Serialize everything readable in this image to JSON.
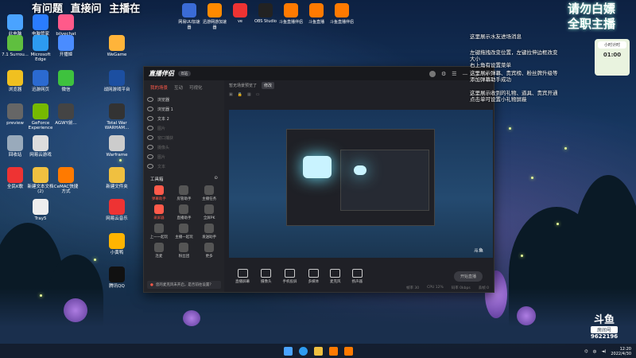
{
  "banner": [
    "有问题",
    "直接问",
    "主播在"
  ],
  "top_icons": [
    {
      "label": "网易UU加速器",
      "color": "#3a6bd6"
    },
    {
      "label": "迅游网游加速器",
      "color": "#ff8a00"
    },
    {
      "label": "ve",
      "color": "#e33"
    },
    {
      "label": "OBS Studio",
      "color": "#222"
    },
    {
      "label": "斗鱼直播伴侣",
      "color": "#ff7a00"
    },
    {
      "label": "斗鱼直播",
      "color": "#ff7a00"
    },
    {
      "label": "斗鱼直播伴侣",
      "color": "#ff7a00"
    }
  ],
  "desktop_icons": [
    {
      "label": "此电脑",
      "color": "#4aa3ff"
    },
    {
      "label": "电脑管家",
      "color": "#2a7cff"
    },
    {
      "label": "bilvechat",
      "color": "#ff5a8a"
    },
    {
      "label": "7.1 Surrou...",
      "color": "#5fbf3f"
    },
    {
      "label": "Microsoft Edge",
      "color": "#2d9bf0"
    },
    {
      "label": "开播姬",
      "color": "#4a8cff"
    },
    {
      "label": "WeGame",
      "color": "#ffb43a"
    },
    {
      "label": "浏览器",
      "color": "#f0c020"
    },
    {
      "label": "迅游网页",
      "color": "#2b6ad0"
    },
    {
      "label": "微信",
      "color": "#3ec23e"
    },
    {
      "label": "战网游戏平台",
      "color": "#1c4fa1"
    },
    {
      "label": "preview",
      "color": "#666"
    },
    {
      "label": "GeForce Experience",
      "color": "#76b900"
    },
    {
      "label": "AGWY前...",
      "color": "#444"
    },
    {
      "label": "Total War WARHAM...",
      "color": "#333"
    },
    {
      "label": "回收站",
      "color": "#9ab"
    },
    {
      "label": "网易云游戏",
      "color": "#ddd"
    },
    {
      "label": "Warframe",
      "color": "#ccc"
    },
    {
      "label": "全民K歌",
      "color": "#e33"
    },
    {
      "label": "新建文本文档(2)",
      "color": "#f0c040"
    },
    {
      "label": "CeMAC快捷方式",
      "color": "#ff7a00"
    },
    {
      "label": "新建文件夹",
      "color": "#f0c040"
    },
    {
      "label": "Tray5",
      "color": "#eee"
    },
    {
      "label": "网易云音乐",
      "color": "#e33"
    },
    {
      "label": "小黄鸭",
      "color": "#ffb400"
    },
    {
      "label": "腾讯QQ",
      "color": "#111"
    }
  ],
  "app": {
    "logo": "直播伴侣",
    "version": "B站",
    "tabs": [
      "我的场景",
      "互动",
      "可视化"
    ],
    "sources": [
      {
        "label": "浏览器",
        "dim": false
      },
      {
        "label": "浏览器 1",
        "dim": false
      },
      {
        "label": "文本 2",
        "dim": false
      },
      {
        "label": "图片",
        "dim": true
      },
      {
        "label": "窗口捕获",
        "dim": true
      },
      {
        "label": "摄像头",
        "dim": true
      },
      {
        "label": "图片",
        "dim": true
      },
      {
        "label": "文本",
        "dim": true
      }
    ],
    "tools_title": "工具箱",
    "tools": [
      {
        "label": "弹幕助手",
        "red": true
      },
      {
        "label": "房管助手",
        "red": false
      },
      {
        "label": "主播任务",
        "red": false
      },
      {
        "label": "录屏器",
        "red": true
      },
      {
        "label": "直播助手",
        "red": false
      },
      {
        "label": "全屏PK",
        "red": false
      },
      {
        "label": "上一一起玩",
        "red": false
      },
      {
        "label": "主播一起玩",
        "red": false
      },
      {
        "label": "发送助手",
        "red": false
      },
      {
        "label": "连麦",
        "red": false
      },
      {
        "label": "粉丝团",
        "red": false
      },
      {
        "label": "更多",
        "red": false
      }
    ],
    "notice": "您的麦克风未开启，是否前往设置？",
    "scene_text": "暂无场景预览了",
    "scene_btn": "修改",
    "controls": [
      "直播屏幕",
      "摄像头",
      "手机投屏",
      "多媒体",
      "麦克风",
      "扬声器"
    ],
    "start_label": "开始直播",
    "status": [
      "帧率 30",
      "CPU 12%",
      "码率 0kbps",
      "丢帧 0"
    ]
  },
  "overlay": [
    "这里展示水友进场消息",
    "左键拖拽改变位置，左键拉伸边框改变",
    "大小",
    "右上角有设置菜单",
    "这里展示弹幕、贵宾榜、粉丝牌升级等",
    "添加弹幕助手成功",
    "这里展示收到的礼物、道具、贵宾开通",
    "点击单可设置小礼物屏蔽"
  ],
  "promo": [
    "请勿白嫖",
    "全职主播"
  ],
  "timer": {
    "label": "小时计时",
    "value": "01:00"
  },
  "douyu": {
    "logo": "斗鱼",
    "subtitle": "房间号",
    "room": "9622196"
  },
  "clock": {
    "time": "12:20",
    "date": "2022/4/30"
  },
  "tray_lang": "中"
}
